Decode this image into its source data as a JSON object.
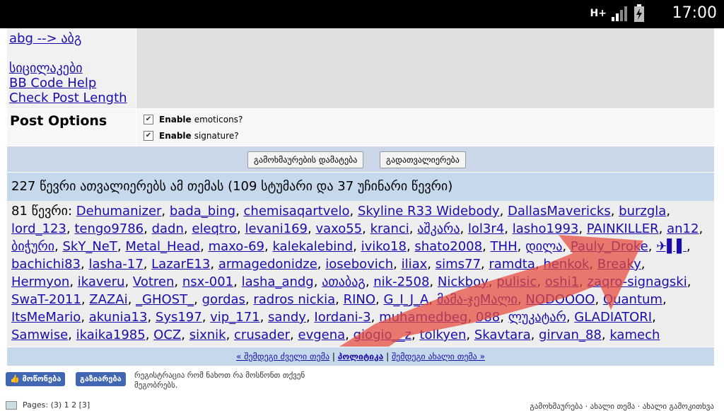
{
  "status_bar": {
    "time": "17:00",
    "network": "H+"
  },
  "left_links": [
    "abg --> აბგ",
    "სიცილაკები",
    "BB Code Help",
    "Check Post Length"
  ],
  "post_options": {
    "label": "Post Options",
    "options": [
      {
        "bold": "Enable",
        "text": "emoticons?"
      },
      {
        "bold": "Enable",
        "text": "signature?"
      }
    ]
  },
  "buttons": {
    "thanks": "გამოხმაურების დამატება",
    "preview": "გადათვალიერება"
  },
  "viewers": {
    "header": "227 წევრი ათვალიერებს ამ თემას (109 სტუმარი და 37 უჩინარი წევრი)",
    "prefix": "81 წევრი:",
    "members": [
      "Dehumanizer",
      "bada_bing",
      "chemisaqartvelo",
      "Skyline R33 Widebody",
      "DallasMavericks",
      "burzgla",
      "lord_123",
      "tengo9786",
      "dadn",
      "eleqtro",
      "levani169",
      "vaxo55",
      "kranci",
      "აშკარა",
      "lol3r4",
      "lasho1993",
      "PAINKILLER",
      "an12",
      "ბიჭური",
      "SkY_NeT",
      "Metal_Head",
      "maxo-69",
      "kalekalebind",
      "iviko18",
      "shato2008",
      "THH",
      "დილა",
      "Pauly_Droke",
      "✈▌▌",
      "bachichi83",
      "lasha-17",
      "LazarE13",
      "armagedonidze",
      "iosebovich",
      "iliax",
      "sims77",
      "ramdta",
      "henkok",
      "Breaky",
      "Hermyon",
      "ikaveru",
      "Votren",
      "nsx-001",
      "lasha_andg",
      "ათაბაგ",
      "nik-2508",
      "Nickboy",
      "pulisic",
      "oshi1",
      "zaqro-signagski",
      "SwaT-2011",
      "ZAZAi",
      "_GHOST_",
      "gordas",
      "radros nickia",
      "RINO",
      "G_I_J_A",
      "მამა-ჯეMალი",
      "NODOOOO",
      "Quantum",
      "ItsMeMario",
      "akunia13",
      "Sys197",
      "vip_171",
      "sandy",
      "Iordani-3",
      "muhamedbeg",
      "088",
      "ლუკატარ",
      "GLADIATORI",
      "Samwise",
      "ikaika1985",
      "OCZ",
      "sixnik",
      "crusader",
      "evgena",
      "giogio__z",
      "tolkyen",
      "Skavtara",
      "girvan_88",
      "kamech"
    ]
  },
  "thread_nav": {
    "prev": "« შემდეგი ძველი თემა",
    "mid": "პოლიტიკა",
    "next": "შემდეგი ახალი თემა »"
  },
  "social": {
    "like": "მოწონება",
    "share": "გაზიარება",
    "text": "რეგისტრაცია რომ ნახოთ რა მოსწონთ თქვენ მეგობრებს."
  },
  "pages": "Pages: (3) 1 2 [3]",
  "bottom_right": "გამოხმაურება · ახალი თემა · ახალი გამოკითხვა"
}
